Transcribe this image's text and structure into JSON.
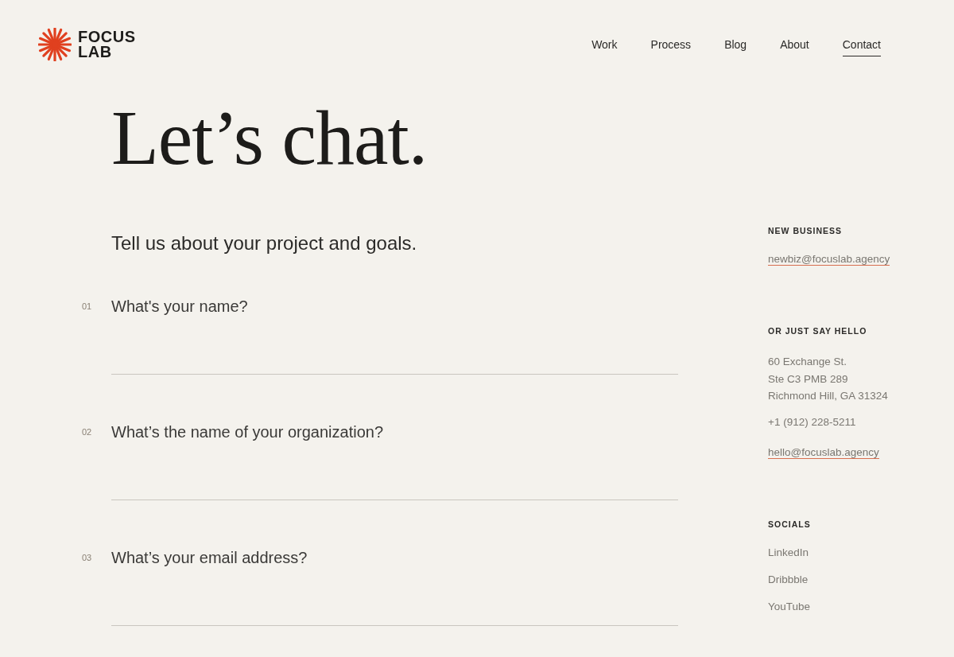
{
  "logo": {
    "line_1": "FOCUS",
    "line_2": "LAB"
  },
  "nav": [
    {
      "label": "Work",
      "selected": false
    },
    {
      "label": "Process",
      "selected": false
    },
    {
      "label": "Blog",
      "selected": false
    },
    {
      "label": "About",
      "selected": false
    },
    {
      "label": "Contact",
      "selected": true
    }
  ],
  "hero": {
    "title": "Let’s chat."
  },
  "form": {
    "intro": "Tell us about your project and goals.",
    "questions": [
      {
        "number": "01",
        "label": "What's your name?"
      },
      {
        "number": "02",
        "label": "What’s the name of your organization?"
      },
      {
        "number": "03",
        "label": "What’s your email address?"
      }
    ]
  },
  "sidebar": [
    {
      "heading": "NEW BUSINESS",
      "items": [
        {
          "kind": "link",
          "text": "newbiz@focuslab.agency"
        }
      ]
    },
    {
      "heading": "OR JUST SAY HELLO",
      "items": [
        {
          "kind": "address",
          "lines": [
            "60 Exchange St.",
            "Ste C3 PMB 289",
            "Richmond Hill, GA 31324"
          ]
        },
        {
          "kind": "text",
          "text": "+1 (912) 228-5211"
        },
        {
          "kind": "link",
          "text": "hello@focuslab.agency"
        }
      ]
    },
    {
      "heading": "SOCIALS",
      "items": [
        {
          "kind": "social",
          "text": "LinkedIn"
        },
        {
          "kind": "social",
          "text": "Dribbble"
        },
        {
          "kind": "social",
          "text": "YouTube"
        }
      ]
    }
  ]
}
